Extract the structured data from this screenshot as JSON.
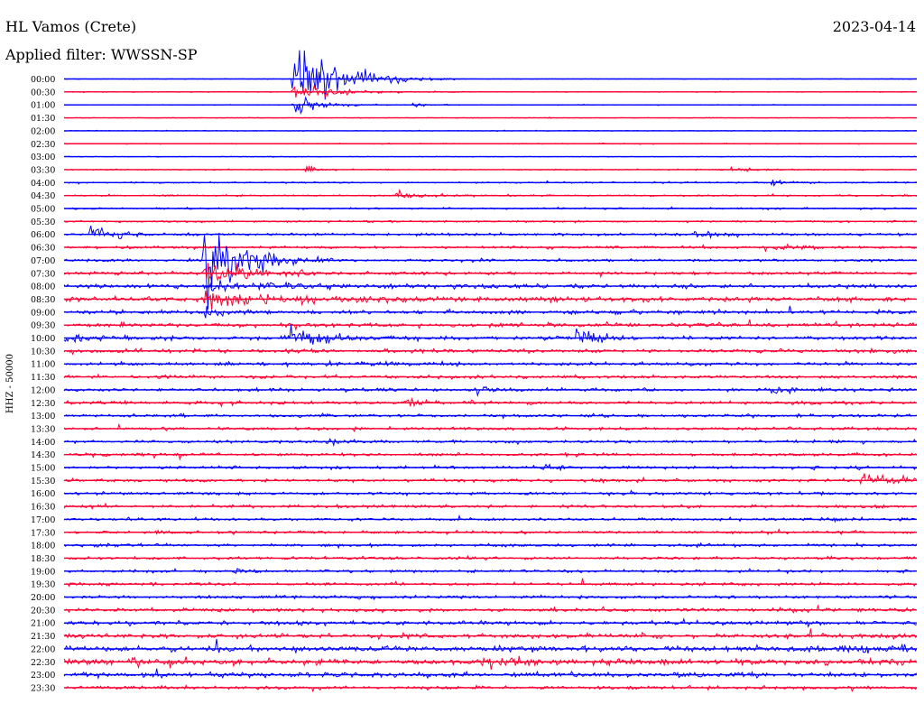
{
  "header": {
    "station": "HL Vamos (Crete)",
    "filter": "Applied filter: WWSSN-SP",
    "date": "2023-04-14"
  },
  "chart_data": {
    "type": "line",
    "ylabel": "HHZ - 50000",
    "colors": [
      "#0000ff",
      "#ff0033"
    ],
    "rows": [
      "00:00",
      "00:30",
      "01:00",
      "01:30",
      "02:00",
      "02:30",
      "03:00",
      "03:30",
      "04:00",
      "04:30",
      "05:00",
      "05:30",
      "06:00",
      "06:30",
      "07:00",
      "07:30",
      "08:00",
      "08:30",
      "09:00",
      "09:30",
      "10:00",
      "10:30",
      "11:00",
      "11:30",
      "12:00",
      "12:30",
      "13:00",
      "13:30",
      "14:00",
      "14:30",
      "15:00",
      "15:30",
      "16:00",
      "16:30",
      "17:00",
      "17:30",
      "18:00",
      "18:30",
      "19:00",
      "19:30",
      "20:00",
      "20:30",
      "21:00",
      "21:30",
      "22:00",
      "22:30",
      "23:00",
      "23:30"
    ],
    "noise": [
      0.5,
      0.7,
      0.6,
      0.6,
      0.7,
      0.8,
      0.6,
      0.9,
      1.3,
      1.3,
      1.4,
      1.6,
      2.0,
      2.0,
      2.2,
      2.5,
      3.2,
      3.6,
      3.2,
      3.4,
      3.0,
      3.0,
      2.8,
      2.7,
      2.6,
      2.6,
      2.4,
      2.4,
      2.4,
      2.4,
      2.4,
      2.4,
      2.4,
      2.4,
      2.3,
      2.3,
      2.3,
      2.3,
      2.3,
      2.3,
      2.5,
      2.8,
      3.2,
      3.6,
      4.2,
      4.4,
      3.8,
      2.6
    ],
    "events": [
      {
        "row": 0,
        "t": 0.27,
        "amp": 62,
        "dur": 0.05
      },
      {
        "row": 1,
        "t": 0.27,
        "amp": 14,
        "dur": 0.05
      },
      {
        "row": 2,
        "t": 0.27,
        "amp": 16,
        "dur": 0.03
      },
      {
        "row": 2,
        "t": 0.41,
        "amp": 6,
        "dur": 0.015
      },
      {
        "row": 7,
        "t": 0.285,
        "amp": 9,
        "dur": 0.01
      },
      {
        "row": 8,
        "t": 0.83,
        "amp": 12,
        "dur": 0.012
      },
      {
        "row": 7,
        "t": 0.78,
        "amp": 5,
        "dur": 0.02
      },
      {
        "row": 9,
        "t": 0.39,
        "amp": 6,
        "dur": 0.05
      },
      {
        "row": 12,
        "t": 0.03,
        "amp": 12,
        "dur": 0.03
      },
      {
        "row": 12,
        "t": 0.74,
        "amp": 7,
        "dur": 0.03
      },
      {
        "row": 13,
        "t": 0.83,
        "amp": 5,
        "dur": 0.03
      },
      {
        "row": 14,
        "t": 0.165,
        "amp": 84,
        "dur": 0.04
      },
      {
        "row": 15,
        "t": 0.165,
        "amp": 28,
        "dur": 0.04
      },
      {
        "row": 16,
        "t": 0.165,
        "amp": 8,
        "dur": 0.09
      },
      {
        "row": 17,
        "t": 0.165,
        "amp": 14,
        "dur": 0.09
      },
      {
        "row": 18,
        "t": 0.165,
        "amp": 9,
        "dur": 0.02
      },
      {
        "row": 20,
        "t": 0.265,
        "amp": 18,
        "dur": 0.05
      },
      {
        "row": 20,
        "t": 0.6,
        "amp": 18,
        "dur": 0.025
      },
      {
        "row": 20,
        "t": 0.0,
        "amp": 8,
        "dur": 0.04
      },
      {
        "row": 22,
        "t": 0.31,
        "amp": 6,
        "dur": 0.03
      },
      {
        "row": 24,
        "t": 0.83,
        "amp": 9,
        "dur": 0.015
      },
      {
        "row": 24,
        "t": 0.48,
        "amp": 8,
        "dur": 0.02
      },
      {
        "row": 25,
        "t": 0.4,
        "amp": 6,
        "dur": 0.02
      },
      {
        "row": 28,
        "t": 0.31,
        "amp": 11,
        "dur": 0.012
      },
      {
        "row": 30,
        "t": 0.56,
        "amp": 9,
        "dur": 0.01
      },
      {
        "row": 31,
        "t": 0.935,
        "amp": 14,
        "dur": 0.04
      },
      {
        "row": 34,
        "t": 0.89,
        "amp": 6,
        "dur": 0.01
      },
      {
        "row": 38,
        "t": 0.2,
        "amp": 8,
        "dur": 0.01
      },
      {
        "row": 45,
        "t": 0.49,
        "amp": 9,
        "dur": 0.05
      },
      {
        "row": 45,
        "t": 0.08,
        "amp": 6,
        "dur": 0.06
      },
      {
        "row": 44,
        "t": 0.85,
        "amp": 5,
        "dur": 0.15
      }
    ]
  }
}
